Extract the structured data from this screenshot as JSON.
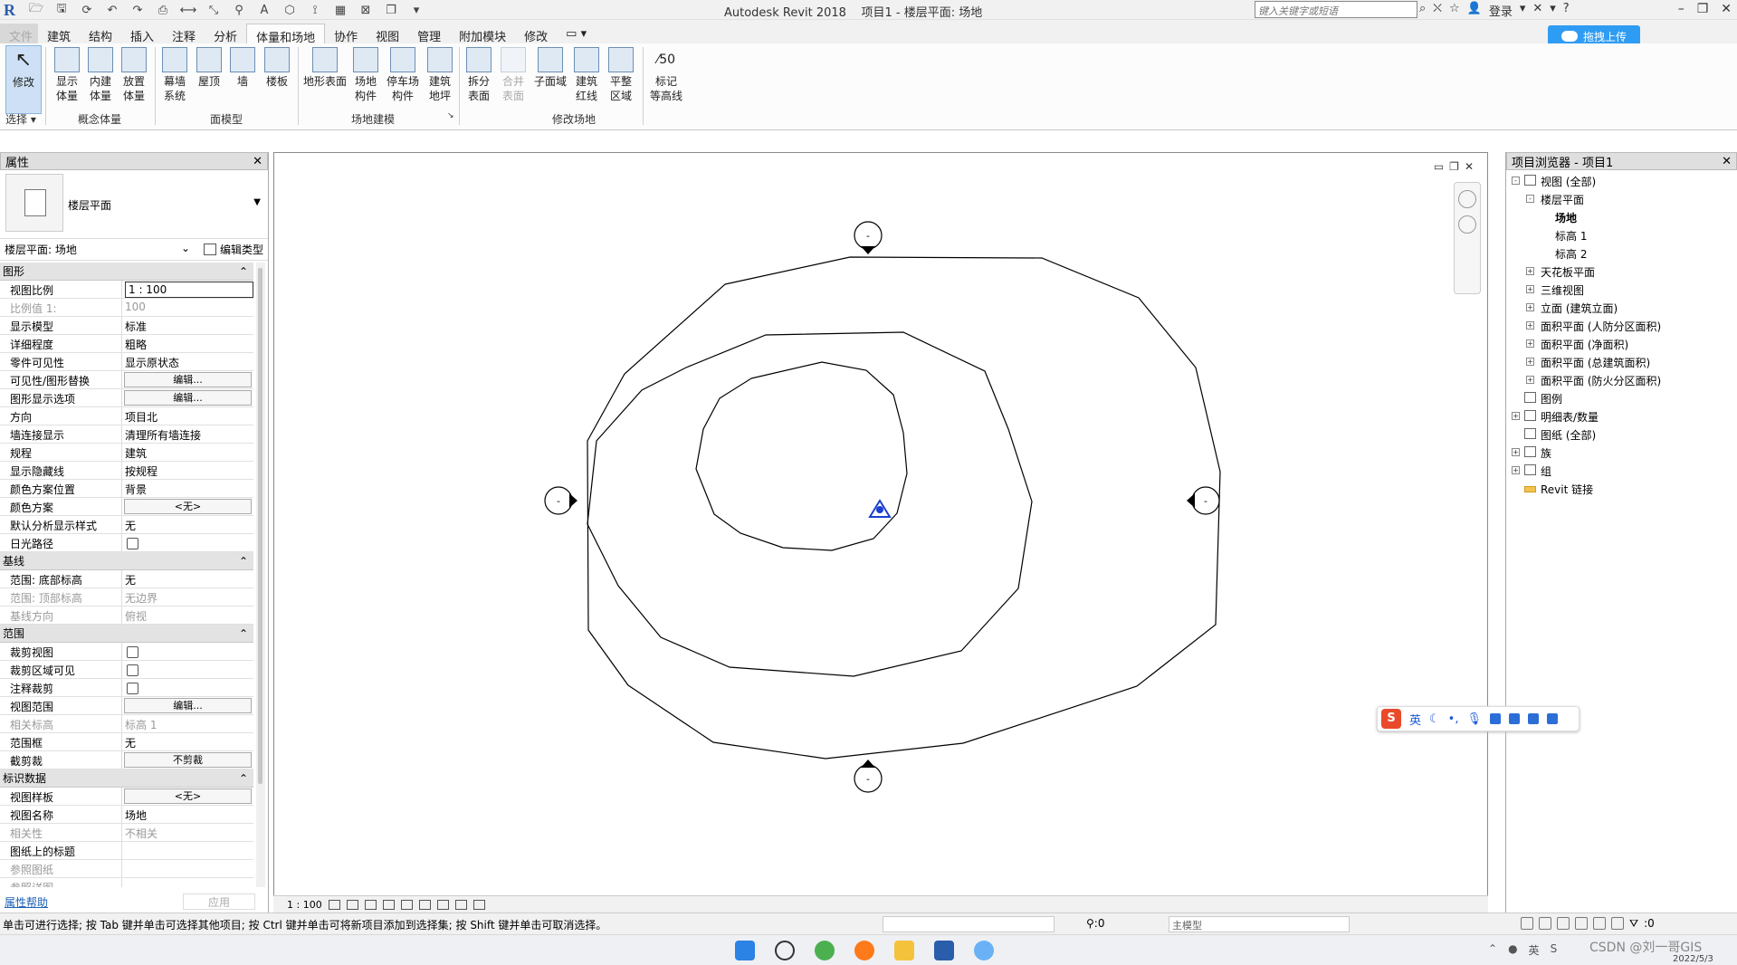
{
  "title": {
    "app": "Autodesk Revit 2018",
    "doc": "项目1 - 楼层平面: 场地",
    "search_placeholder": "键入关键字或短语",
    "login": "登录",
    "help": "?"
  },
  "tabs": [
    "文件",
    "建筑",
    "结构",
    "插入",
    "注释",
    "分析",
    "体量和场地",
    "协作",
    "视图",
    "管理",
    "附加模块",
    "修改"
  ],
  "upload": "拖拽上传",
  "ribbon": {
    "select": {
      "label": "修改",
      "panel": "选择 ▾"
    },
    "buttons": [
      {
        "id": "show-mass",
        "label": "显示\n体量"
      },
      {
        "id": "inplace-mass",
        "label": "内建\n体量"
      },
      {
        "id": "place-mass",
        "label": "放置\n体量"
      },
      {
        "id": "curtain-system",
        "label": "幕墙\n系统"
      },
      {
        "id": "roof",
        "label": "屋顶"
      },
      {
        "id": "wall",
        "label": "墙"
      },
      {
        "id": "floor",
        "label": "楼板"
      },
      {
        "id": "toposurface",
        "label": "地形表面"
      },
      {
        "id": "site-component",
        "label": "场地\n构件"
      },
      {
        "id": "parking-component",
        "label": "停车场\n构件"
      },
      {
        "id": "building-pad",
        "label": "建筑\n地坪"
      },
      {
        "id": "split-surface",
        "label": "拆分\n表面"
      },
      {
        "id": "merge-surface",
        "label": "合并\n表面"
      },
      {
        "id": "subregion",
        "label": "子面域"
      },
      {
        "id": "property-line",
        "label": "建筑\n红线"
      },
      {
        "id": "graded-region",
        "label": "平整\n区域"
      },
      {
        "id": "label-contours",
        "label": "标记\n等高线"
      }
    ],
    "panels": [
      "概念体量",
      "面模型",
      "场地建模",
      "修改场地"
    ]
  },
  "properties": {
    "header": "属性",
    "type_name": "楼层平面",
    "instance": "楼层平面: 场地",
    "edit_type": "编辑类型",
    "sections": [
      {
        "name": "图形",
        "rows": [
          {
            "k": "视图比例",
            "v": "1 : 100",
            "style": "box"
          },
          {
            "k": "比例值 1:",
            "v": "100",
            "dis": true
          },
          {
            "k": "显示模型",
            "v": "标准"
          },
          {
            "k": "详细程度",
            "v": "粗略"
          },
          {
            "k": "零件可见性",
            "v": "显示原状态"
          },
          {
            "k": "可见性/图形替换",
            "v": "编辑...",
            "style": "btn"
          },
          {
            "k": "图形显示选项",
            "v": "编辑...",
            "style": "btn"
          },
          {
            "k": "方向",
            "v": "项目北"
          },
          {
            "k": "墙连接显示",
            "v": "清理所有墙连接"
          },
          {
            "k": "规程",
            "v": "建筑"
          },
          {
            "k": "显示隐藏线",
            "v": "按规程"
          },
          {
            "k": "颜色方案位置",
            "v": "背景"
          },
          {
            "k": "颜色方案",
            "v": "<无>",
            "style": "btn"
          },
          {
            "k": "默认分析显示样式",
            "v": "无"
          },
          {
            "k": "日光路径",
            "v": "",
            "style": "cb"
          }
        ]
      },
      {
        "name": "基线",
        "rows": [
          {
            "k": "范围: 底部标高",
            "v": "无"
          },
          {
            "k": "范围: 顶部标高",
            "v": "无边界",
            "dis": true
          },
          {
            "k": "基线方向",
            "v": "俯视",
            "dis": true
          }
        ]
      },
      {
        "name": "范围",
        "rows": [
          {
            "k": "裁剪视图",
            "v": "",
            "style": "cb"
          },
          {
            "k": "裁剪区域可见",
            "v": "",
            "style": "cb"
          },
          {
            "k": "注释裁剪",
            "v": "",
            "style": "cb"
          },
          {
            "k": "视图范围",
            "v": "编辑...",
            "style": "btn"
          },
          {
            "k": "相关标高",
            "v": "标高 1",
            "dis": true
          },
          {
            "k": "范围框",
            "v": "无"
          },
          {
            "k": "截剪裁",
            "v": "不剪裁",
            "style": "btn"
          }
        ]
      },
      {
        "name": "标识数据",
        "rows": [
          {
            "k": "视图样板",
            "v": "<无>",
            "style": "btn"
          },
          {
            "k": "视图名称",
            "v": "场地"
          },
          {
            "k": "相关性",
            "v": "不相关",
            "dis": true
          },
          {
            "k": "图纸上的标题",
            "v": ""
          },
          {
            "k": "参照图纸",
            "v": "",
            "dis": true
          },
          {
            "k": "参照详图",
            "v": "",
            "dis": true
          }
        ]
      }
    ],
    "help_link": "属性帮助",
    "apply": "应用"
  },
  "view": {
    "scale": "1 : 100",
    "elevation_marker": "-"
  },
  "browser": {
    "header": "项目浏览器 - 项目1",
    "items": [
      {
        "label": "视图 (全部)",
        "lvl": 0,
        "exp": "-"
      },
      {
        "label": "楼层平面",
        "lvl": 1,
        "exp": "-"
      },
      {
        "label": "场地",
        "lvl": 2,
        "bold": true
      },
      {
        "label": "标高 1",
        "lvl": 2
      },
      {
        "label": "标高 2",
        "lvl": 2
      },
      {
        "label": "天花板平面",
        "lvl": 1,
        "exp": "+"
      },
      {
        "label": "三维视图",
        "lvl": 1,
        "exp": "+"
      },
      {
        "label": "立面 (建筑立面)",
        "lvl": 1,
        "exp": "+"
      },
      {
        "label": "面积平面 (人防分区面积)",
        "lvl": 1,
        "exp": "+"
      },
      {
        "label": "面积平面 (净面积)",
        "lvl": 1,
        "exp": "+"
      },
      {
        "label": "面积平面 (总建筑面积)",
        "lvl": 1,
        "exp": "+"
      },
      {
        "label": "面积平面 (防火分区面积)",
        "lvl": 1,
        "exp": "+"
      },
      {
        "label": "图例",
        "lvl": 0
      },
      {
        "label": "明细表/数量",
        "lvl": 0,
        "exp": "+"
      },
      {
        "label": "图纸 (全部)",
        "lvl": 0
      },
      {
        "label": "族",
        "lvl": 0,
        "exp": "+"
      },
      {
        "label": "组",
        "lvl": 0,
        "exp": "+"
      },
      {
        "label": "Revit 链接",
        "lvl": 0
      }
    ]
  },
  "status": {
    "message": "单击可进行选择; 按 Tab 键并单击可选择其他项目; 按 Ctrl 键并单击可将新项目添加到选择集; 按 Shift 键并单击可取消选择。",
    "selection_count": ":0",
    "model": "主模型",
    "filter_count": ":0"
  },
  "ime": {
    "lang": "英"
  },
  "watermark": "CSDN @刘一哥GIS",
  "date": "2022/5/3"
}
